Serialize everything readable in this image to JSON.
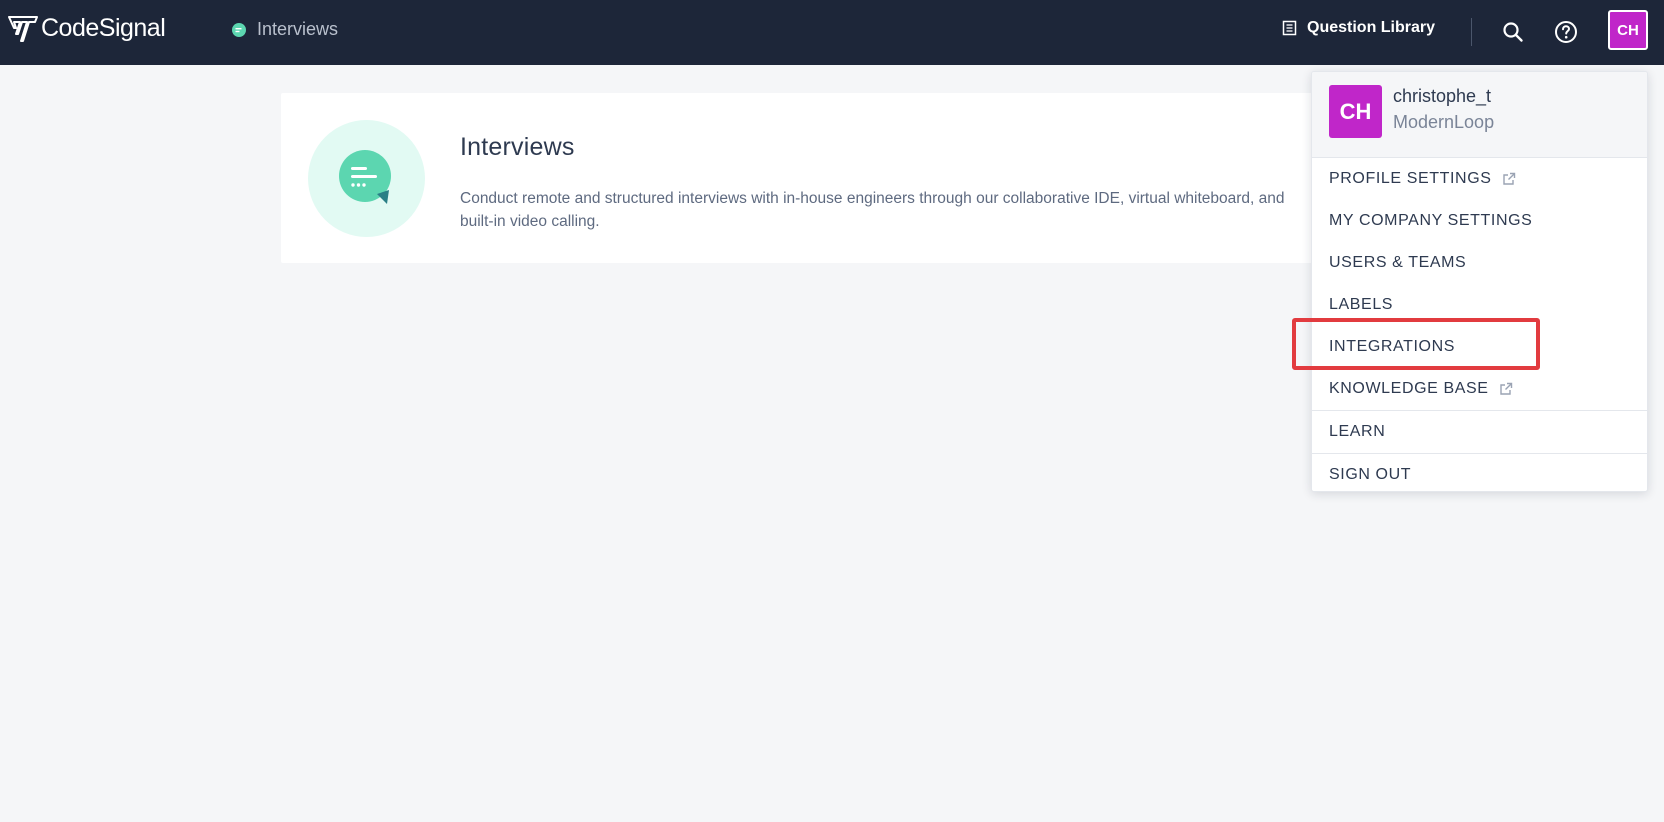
{
  "header": {
    "logo_text": "CodeSignal",
    "product_label": "Interviews",
    "question_library_label": "Question Library",
    "avatar_initials": "CH",
    "colors": {
      "background": "#1d2639",
      "product_dot": "#5cd6b0",
      "avatar": "#c026c9"
    },
    "icons": [
      "codesignal-logo-icon",
      "interviews-dot-icon",
      "book-icon",
      "search-icon",
      "help-icon"
    ]
  },
  "product_card": {
    "title": "Interviews",
    "description": "Conduct remote and structured interviews with in-house engineers through our collaborative IDE, virtual whiteboard, and built-in video calling.",
    "icon": "chat-bubble-icon"
  },
  "user_menu": {
    "avatar_initials": "CH",
    "username": "christophe_t",
    "company": "ModernLoop",
    "items": [
      {
        "label": "PROFILE SETTINGS",
        "external": true
      },
      {
        "label": "MY COMPANY SETTINGS",
        "external": false
      },
      {
        "label": "USERS & TEAMS",
        "external": false
      },
      {
        "label": "LABELS",
        "external": false
      },
      {
        "label": "INTEGRATIONS",
        "external": false,
        "highlighted": true
      },
      {
        "label": "KNOWLEDGE BASE",
        "external": true
      },
      {
        "label": "LEARN",
        "external": false
      },
      {
        "label": "SIGN OUT",
        "external": false
      }
    ]
  },
  "annotation": {
    "highlight_color": "#e23b3f",
    "highlighted_item": "INTEGRATIONS"
  }
}
